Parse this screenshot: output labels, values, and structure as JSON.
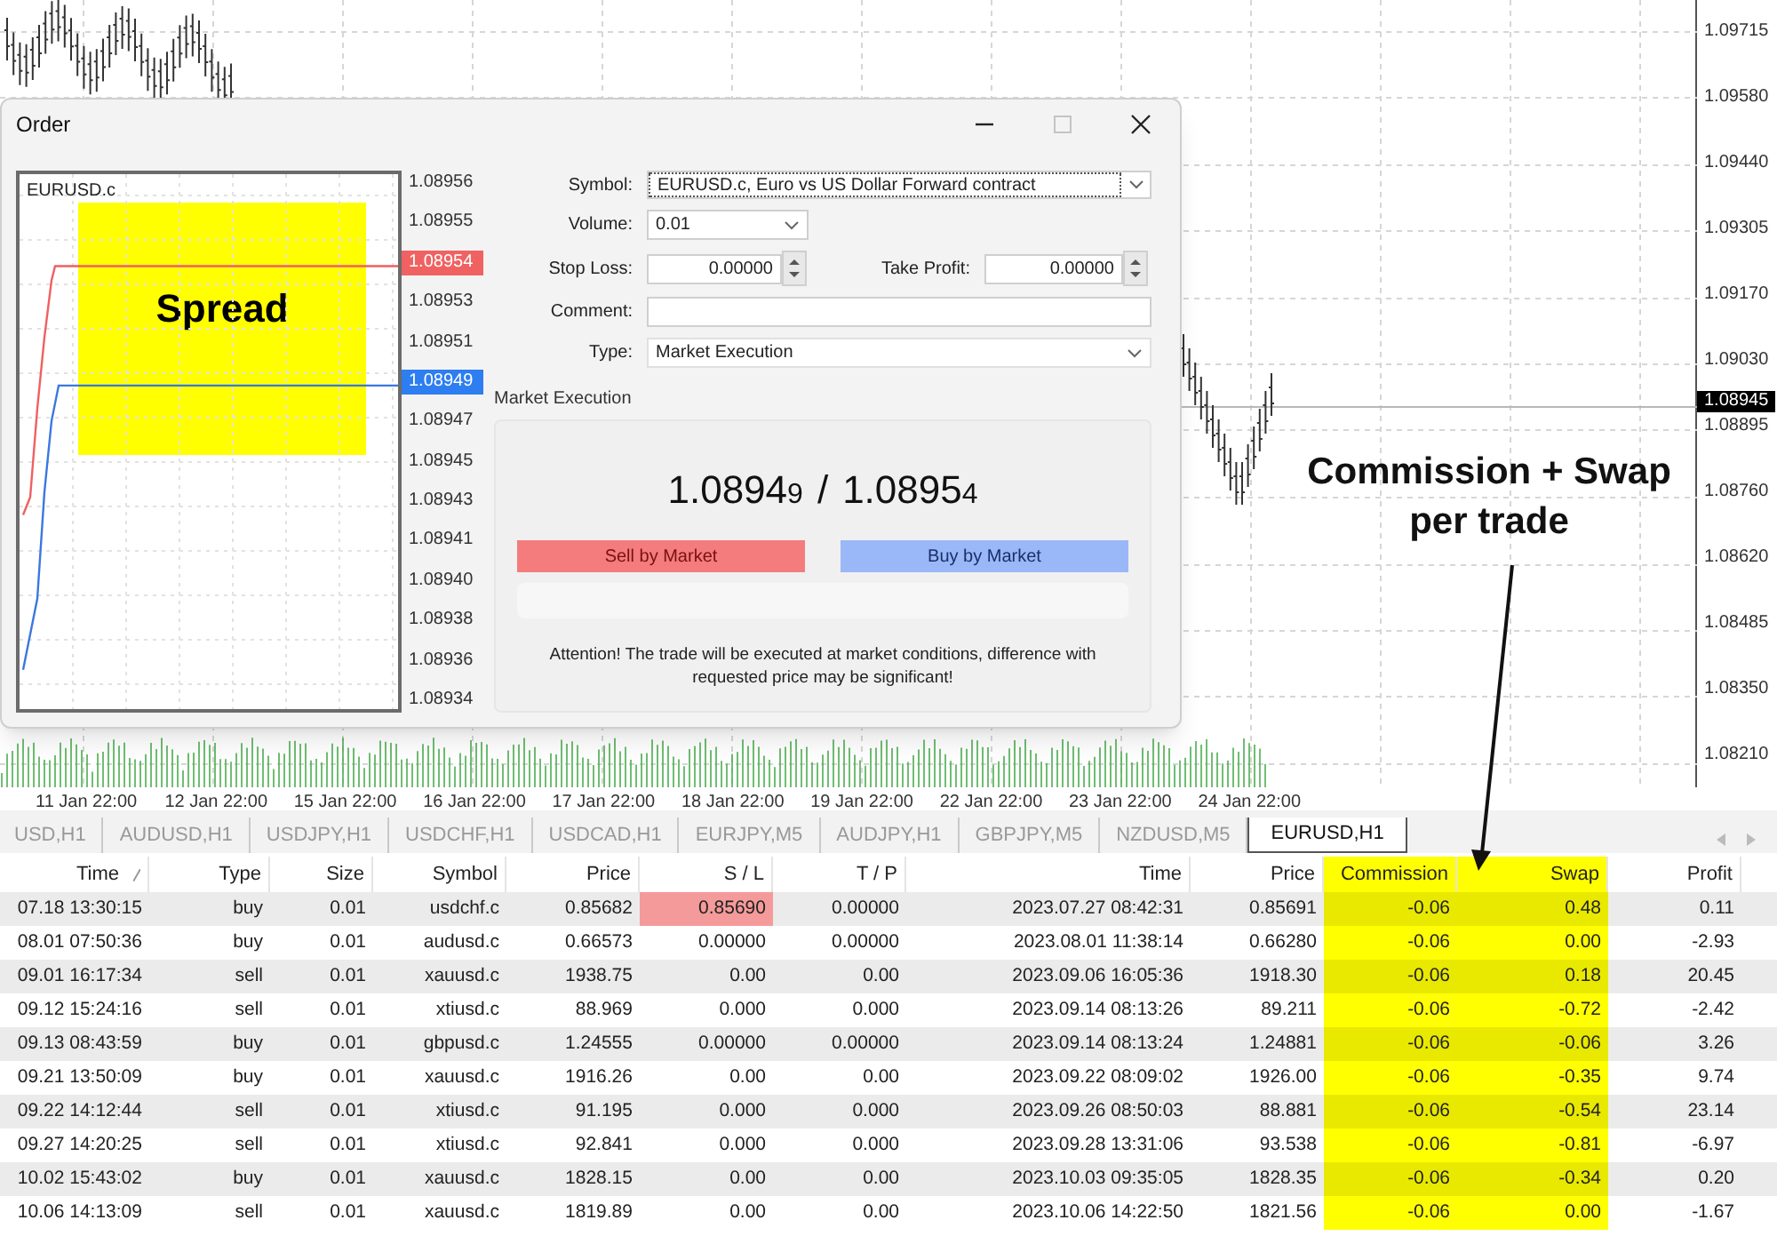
{
  "chart": {
    "price_axis": {
      "labels": [
        "1.09715",
        "1.09580",
        "1.09440",
        "1.09305",
        "1.09170",
        "1.09030",
        "1.08895",
        "1.08760",
        "1.08620",
        "1.08485",
        "1.08350",
        "1.08210"
      ],
      "current": "1.08945"
    },
    "time_axis": [
      "11 Jan 22:00",
      "12 Jan 22:00",
      "15 Jan 22:00",
      "16 Jan 22:00",
      "17 Jan 22:00",
      "18 Jan 22:00",
      "19 Jan 22:00",
      "22 Jan 22:00",
      "23 Jan 22:00",
      "24 Jan 22:00"
    ],
    "annotation": "Commission + Swap per trade"
  },
  "order": {
    "title": "Order",
    "window_controls": [
      {
        "kind": "minimize",
        "disabled": false
      },
      {
        "kind": "maximize",
        "disabled": true
      },
      {
        "kind": "close",
        "disabled": false
      }
    ],
    "chart": {
      "symbol": "EURUSD.c",
      "annotation": "Spread",
      "axis": [
        {
          "kind": "label",
          "text": "1.08956"
        },
        {
          "kind": "label",
          "text": "1.08955"
        },
        {
          "kind": "ask",
          "text": "1.08954"
        },
        {
          "kind": "label",
          "text": "1.08953"
        },
        {
          "kind": "label",
          "text": "1.08951"
        },
        {
          "kind": "bid",
          "text": "1.08949"
        },
        {
          "kind": "label",
          "text": "1.08947"
        },
        {
          "kind": "label",
          "text": "1.08945"
        },
        {
          "kind": "label",
          "text": "1.08943"
        },
        {
          "kind": "label",
          "text": "1.08941"
        },
        {
          "kind": "label",
          "text": "1.08940"
        },
        {
          "kind": "label",
          "text": "1.08938"
        },
        {
          "kind": "label",
          "text": "1.08936"
        },
        {
          "kind": "label",
          "text": "1.08934"
        }
      ]
    },
    "form": {
      "symbol": {
        "label": "Symbol:",
        "value": "EURUSD.c, Euro vs US Dollar Forward contract"
      },
      "volume": {
        "label": "Volume:",
        "value": "0.01"
      },
      "stop_loss": {
        "label": "Stop Loss:",
        "value": "0.00000"
      },
      "take_profit": {
        "label": "Take Profit:",
        "value": "0.00000"
      },
      "comment": {
        "label": "Comment:"
      },
      "type": {
        "label": "Type:",
        "value": "Market Execution"
      }
    },
    "section_label": "Market Execution",
    "quote": {
      "bid": {
        "main": "1.0894",
        "pip": "9"
      },
      "separator": "/",
      "ask": {
        "main": "1.0895",
        "pip": "4"
      }
    },
    "buttons": [
      {
        "kind": "sell",
        "label": "Sell by Market"
      },
      {
        "kind": "buy",
        "label": "Buy by Market"
      }
    ],
    "notice": "Attention! The trade will be executed at market conditions, difference with requested price may be significant!"
  },
  "tabs": [
    {
      "label": "USD,H1",
      "selected": false
    },
    {
      "label": "AUDUSD,H1",
      "selected": false
    },
    {
      "label": "USDJPY,H1",
      "selected": false
    },
    {
      "label": "USDCHF,H1",
      "selected": false
    },
    {
      "label": "USDCAD,H1",
      "selected": false
    },
    {
      "label": "EURJPY,M5",
      "selected": false
    },
    {
      "label": "AUDJPY,H1",
      "selected": false
    },
    {
      "label": "GBPJPY,M5",
      "selected": false
    },
    {
      "label": "NZDUSD,M5",
      "selected": false
    },
    {
      "label": "EURUSD,H1",
      "selected": true
    }
  ],
  "table": {
    "columns": [
      {
        "label": "Time",
        "sorted": true,
        "highlighted": false
      },
      {
        "label": "Type",
        "sorted": false,
        "highlighted": false
      },
      {
        "label": "Size",
        "sorted": false,
        "highlighted": false
      },
      {
        "label": "Symbol",
        "sorted": false,
        "highlighted": false
      },
      {
        "label": "Price",
        "sorted": false,
        "highlighted": false
      },
      {
        "label": "S / L",
        "sorted": false,
        "highlighted": false
      },
      {
        "label": "T / P",
        "sorted": false,
        "highlighted": false
      },
      {
        "label": "Time",
        "sorted": false,
        "highlighted": false
      },
      {
        "label": "Price",
        "sorted": false,
        "highlighted": false
      },
      {
        "label": "Commission",
        "sorted": false,
        "highlighted": true
      },
      {
        "label": "Swap",
        "sorted": false,
        "highlighted": true
      },
      {
        "label": "Profit",
        "sorted": false,
        "highlighted": false
      }
    ],
    "rows": [
      {
        "sl_highlight": true,
        "cells": [
          "07.18 13:30:15",
          "buy",
          "0.01",
          "usdchf.c",
          "0.85682",
          "0.85690",
          "0.00000",
          "2023.07.27 08:42:31",
          "0.85691",
          "-0.06",
          "0.48",
          "0.11"
        ]
      },
      {
        "sl_highlight": false,
        "cells": [
          "08.01 07:50:36",
          "buy",
          "0.01",
          "audusd.c",
          "0.66573",
          "0.00000",
          "0.00000",
          "2023.08.01 11:38:14",
          "0.66280",
          "-0.06",
          "0.00",
          "-2.93"
        ]
      },
      {
        "sl_highlight": false,
        "cells": [
          "09.01 16:17:34",
          "sell",
          "0.01",
          "xauusd.c",
          "1938.75",
          "0.00",
          "0.00",
          "2023.09.06 16:05:36",
          "1918.30",
          "-0.06",
          "0.18",
          "20.45"
        ]
      },
      {
        "sl_highlight": false,
        "cells": [
          "09.12 15:24:16",
          "sell",
          "0.01",
          "xtiusd.c",
          "88.969",
          "0.000",
          "0.000",
          "2023.09.14 08:13:26",
          "89.211",
          "-0.06",
          "-0.72",
          "-2.42"
        ]
      },
      {
        "sl_highlight": false,
        "cells": [
          "09.13 08:43:59",
          "buy",
          "0.01",
          "gbpusd.c",
          "1.24555",
          "0.00000",
          "0.00000",
          "2023.09.14 08:13:24",
          "1.24881",
          "-0.06",
          "-0.06",
          "3.26"
        ]
      },
      {
        "sl_highlight": false,
        "cells": [
          "09.21 13:50:09",
          "buy",
          "0.01",
          "xauusd.c",
          "1916.26",
          "0.00",
          "0.00",
          "2023.09.22 08:09:02",
          "1926.00",
          "-0.06",
          "-0.35",
          "9.74"
        ]
      },
      {
        "sl_highlight": false,
        "cells": [
          "09.22 14:12:44",
          "sell",
          "0.01",
          "xtiusd.c",
          "91.195",
          "0.000",
          "0.000",
          "2023.09.26 08:50:03",
          "88.881",
          "-0.06",
          "-0.54",
          "23.14"
        ]
      },
      {
        "sl_highlight": false,
        "cells": [
          "09.27 14:20:25",
          "sell",
          "0.01",
          "xtiusd.c",
          "92.841",
          "0.000",
          "0.000",
          "2023.09.28 13:31:06",
          "93.538",
          "-0.06",
          "-0.81",
          "-6.97"
        ]
      },
      {
        "sl_highlight": false,
        "cells": [
          "10.02 15:43:02",
          "buy",
          "0.01",
          "xauusd.c",
          "1828.15",
          "0.00",
          "0.00",
          "2023.10.03 09:35:05",
          "1828.35",
          "-0.06",
          "-0.34",
          "0.20"
        ]
      },
      {
        "sl_highlight": false,
        "cells": [
          "10.06 14:13:09",
          "sell",
          "0.01",
          "xauusd.c",
          "1819.89",
          "0.00",
          "0.00",
          "2023.10.06 14:22:50",
          "1821.56",
          "-0.06",
          "0.00",
          "-1.67"
        ]
      }
    ]
  }
}
